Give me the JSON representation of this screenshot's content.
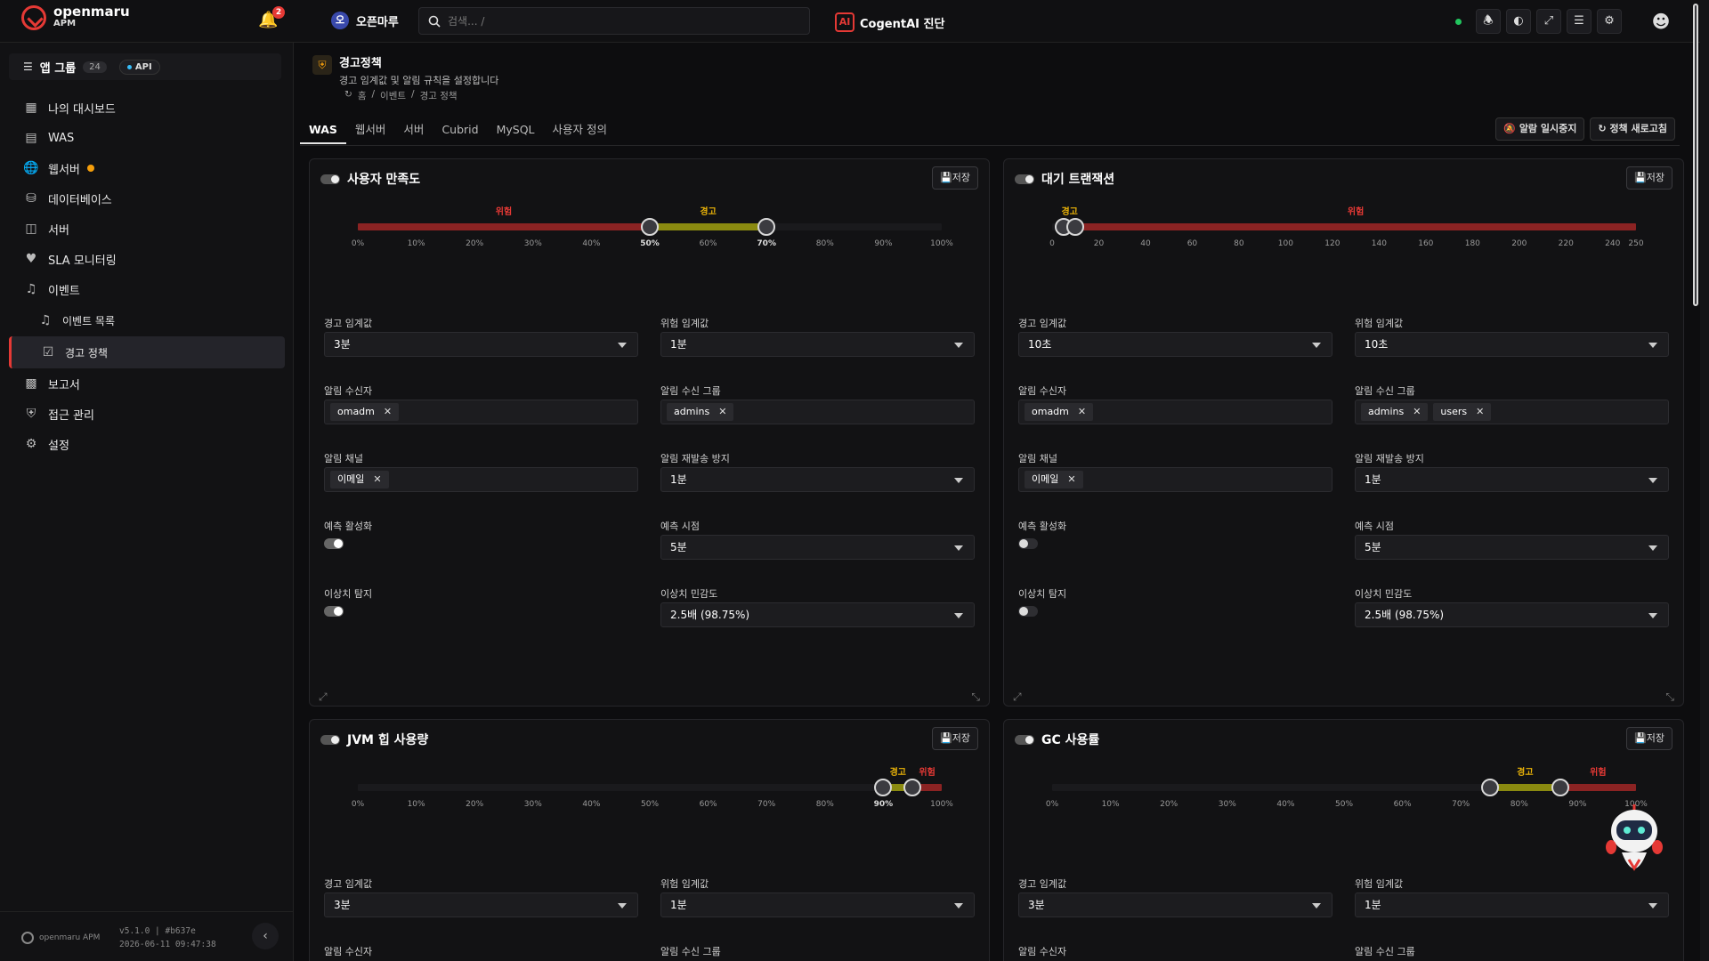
{
  "topbar": {
    "logo_name": "openmaru",
    "logo_sub": "APM",
    "notif_count": "2",
    "workspace_initial": "오",
    "workspace_name": "오픈마루",
    "search_placeholder": "검색... /",
    "cogent_icon": "AI",
    "cogent_label": "CogentAI 진단",
    "status_color": "#22c55e"
  },
  "sidebar": {
    "app_group_label": "앱 그룹",
    "app_group_count": "24",
    "api_label": "API",
    "items": [
      {
        "label": "나의 대시보드",
        "icon": "dashboard-icon"
      },
      {
        "label": "WAS",
        "icon": "server-stack-icon"
      },
      {
        "label": "웹서버",
        "icon": "globe-icon"
      },
      {
        "label": "데이터베이스",
        "icon": "database-icon"
      },
      {
        "label": "서버",
        "icon": "monitor-icon"
      },
      {
        "label": "SLA 모니터링",
        "icon": "heart-pulse-icon"
      },
      {
        "label": "이벤트",
        "icon": "bell-icon"
      },
      {
        "label": "이벤트 목록",
        "icon": "bell-icon"
      },
      {
        "label": "경고 정책",
        "icon": "checkbox-icon"
      },
      {
        "label": "보고서",
        "icon": "chart-icon"
      },
      {
        "label": "접근 관리",
        "icon": "shield-icon"
      },
      {
        "label": "설정",
        "icon": "gears-icon"
      }
    ],
    "footer_logo": "openmaru APM",
    "version": "v5.1.0 | #b637e",
    "build_time": "2026-06-11 09:47:38"
  },
  "page": {
    "title": "경고정책",
    "subtitle": "경고 임계값 및 알림 규칙을 설정합니다",
    "breadcrumb": [
      "홈",
      "이벤트",
      "경고 정책"
    ],
    "tabs": [
      "WAS",
      "웹서버",
      "서버",
      "Cubrid",
      "MySQL",
      "사용자 정의"
    ],
    "active_tab": "WAS",
    "pause_btn": "알람 일시중지",
    "refresh_btn": "정책 새로고침"
  },
  "labels": {
    "save": "저장",
    "warn_threshold": "경고 임계값",
    "danger_threshold": "위험 임계값",
    "recipient": "알림 수신자",
    "recipient_group": "알림 수신 그룹",
    "channel": "알림 채널",
    "resend": "알림 재발송 방지",
    "predict_on": "예측 활성화",
    "predict_time": "예측 시점",
    "anomaly": "이상치 탐지",
    "anomaly_sens": "이상치 민감도",
    "warn": "경고",
    "danger": "위험"
  },
  "colors": {
    "danger": "#e53935",
    "warning": "#eab308",
    "danger_track": "#8b2323",
    "warn_track": "#8a8a10"
  },
  "cards": [
    {
      "title": "사용자 만족도",
      "enabled": true,
      "slider": {
        "min": 0,
        "max": 100,
        "unit": "%",
        "warn": 50,
        "danger": 70,
        "direction": "low-is-danger",
        "ticks": [
          "0%",
          "10%",
          "20%",
          "30%",
          "40%",
          "50%",
          "60%",
          "70%",
          "80%",
          "90%",
          "100%"
        ]
      },
      "warn_threshold": "3분",
      "danger_threshold": "1분",
      "recipients": [
        "omadm"
      ],
      "recipient_groups": [
        "admins"
      ],
      "channels": [
        "이메일"
      ],
      "resend": "1분",
      "predict_enabled": true,
      "predict_time": "5분",
      "anomaly_enabled": true,
      "anomaly_sens": "2.5배 (98.75%)"
    },
    {
      "title": "대기 트랜잭션",
      "enabled": true,
      "slider": {
        "min": 0,
        "max": 250,
        "unit": "",
        "warn": 5,
        "danger": 10,
        "direction": "high-is-danger",
        "ticks": [
          "0",
          "20",
          "40",
          "60",
          "80",
          "100",
          "120",
          "140",
          "160",
          "180",
          "200",
          "220",
          "240",
          "250"
        ]
      },
      "warn_threshold": "10초",
      "danger_threshold": "10초",
      "recipients": [
        "omadm"
      ],
      "recipient_groups": [
        "admins",
        "users"
      ],
      "channels": [
        "이메일"
      ],
      "resend": "1분",
      "predict_enabled": false,
      "predict_time": "5분",
      "anomaly_enabled": false,
      "anomaly_sens": "2.5배 (98.75%)"
    },
    {
      "title": "JVM 힙 사용량",
      "enabled": true,
      "slider": {
        "min": 0,
        "max": 100,
        "unit": "%",
        "warn": 90,
        "danger": 95,
        "direction": "high-is-danger",
        "ticks": [
          "0%",
          "10%",
          "20%",
          "30%",
          "40%",
          "50%",
          "60%",
          "70%",
          "80%",
          "90%",
          "100%"
        ]
      },
      "warn_threshold": "3분",
      "danger_threshold": "1분",
      "recipients_label_only": true
    },
    {
      "title": "GC 사용률",
      "enabled": true,
      "slider": {
        "min": 0,
        "max": 100,
        "unit": "%",
        "warn": 75,
        "danger": 87,
        "direction": "high-is-danger",
        "ticks": [
          "0%",
          "10%",
          "20%",
          "30%",
          "40%",
          "50%",
          "60%",
          "70%",
          "80%",
          "90%",
          "100%"
        ]
      },
      "warn_threshold": "3분",
      "danger_threshold": "1분",
      "recipients_label_only": true
    }
  ]
}
